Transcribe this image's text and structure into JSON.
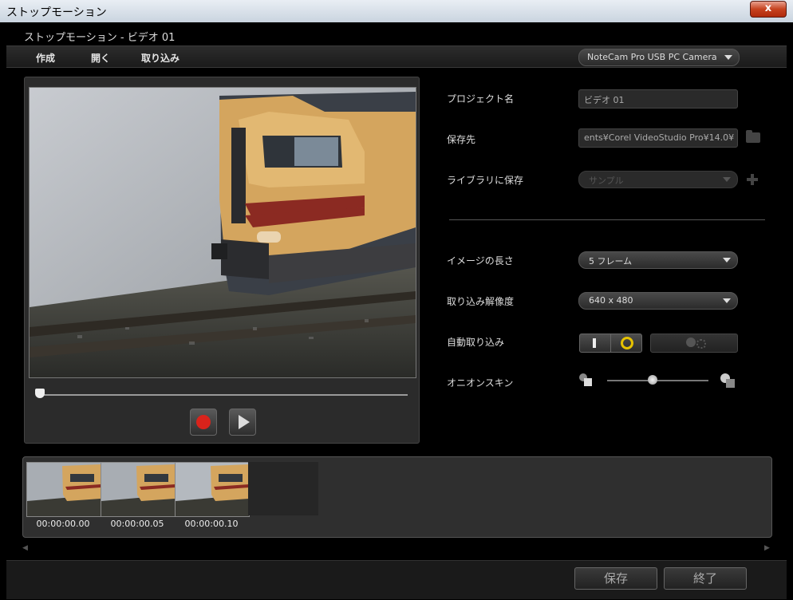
{
  "window": {
    "title": "ストップモーション",
    "close_glyph": "x"
  },
  "subtitle": "ストップモーション - ビデオ 01",
  "menu": {
    "create": "作成",
    "open": "開く",
    "import": "取り込み"
  },
  "camera": {
    "selected": "NoteCam Pro USB PC Camera"
  },
  "labels": {
    "project_name": "プロジェクト名",
    "save_to": "保存先",
    "save_library": "ライブラリに保存",
    "image_length": "イメージの長さ",
    "capture_resolution": "取り込み解像度",
    "auto_capture": "自動取り込み",
    "onion_skin": "オニオンスキン"
  },
  "fields": {
    "project_name_value": "ビデオ 01",
    "save_path_value": "ents¥Corel VideoStudio Pro¥14.0¥",
    "library_value": "サンプル",
    "image_length_value": "5 フレーム",
    "resolution_value": "640 x 480"
  },
  "onion_skin_level": 0.45,
  "timeline": [
    {
      "time": "00:00:00.00"
    },
    {
      "time": "00:00:00.05"
    },
    {
      "time": "00:00:00.10"
    }
  ],
  "buttons": {
    "save": "保存",
    "finish": "終了"
  },
  "icons": {
    "close": "close-icon",
    "folder": "folder-icon",
    "add": "plus-icon",
    "record": "record-icon",
    "play": "play-icon",
    "timer": "timer-icon"
  },
  "colors": {
    "record": "#d9231b",
    "accent": "#e6c200"
  }
}
